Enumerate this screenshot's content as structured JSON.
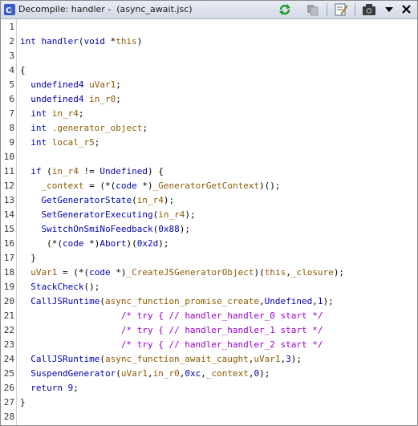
{
  "window": {
    "title": "Decompile: handler -  (async_await.jsc)"
  },
  "toolbar": {
    "icons": [
      "refresh-icon",
      "copy-icon",
      "edit-icon",
      "snapshot-icon",
      "dropdown-icon",
      "close-icon"
    ]
  },
  "code": {
    "lines": [
      {
        "n": "1",
        "tokens": []
      },
      {
        "n": "2",
        "tokens": [
          [
            "tp",
            "int"
          ],
          [
            "pl",
            " "
          ],
          [
            "fn",
            "handler"
          ],
          [
            "pl",
            "("
          ],
          [
            "tp",
            "void"
          ],
          [
            "pl",
            " *"
          ],
          [
            "vr",
            "this"
          ],
          [
            "pl",
            ")"
          ]
        ]
      },
      {
        "n": "3",
        "tokens": []
      },
      {
        "n": "4",
        "tokens": [
          [
            "pl",
            "{"
          ]
        ]
      },
      {
        "n": "5",
        "tokens": [
          [
            "pl",
            "  "
          ],
          [
            "tp",
            "undefined4"
          ],
          [
            "pl",
            " "
          ],
          [
            "vr",
            "uVar1"
          ],
          [
            "pl",
            ";"
          ]
        ]
      },
      {
        "n": "6",
        "tokens": [
          [
            "pl",
            "  "
          ],
          [
            "tp",
            "undefined4"
          ],
          [
            "pl",
            " "
          ],
          [
            "vr",
            "in_r0"
          ],
          [
            "pl",
            ";"
          ]
        ]
      },
      {
        "n": "7",
        "tokens": [
          [
            "pl",
            "  "
          ],
          [
            "tp",
            "int"
          ],
          [
            "pl",
            " "
          ],
          [
            "vr",
            "in_r4"
          ],
          [
            "pl",
            ";"
          ]
        ]
      },
      {
        "n": "8",
        "tokens": [
          [
            "pl",
            "  "
          ],
          [
            "tp",
            "int"
          ],
          [
            "pl",
            " "
          ],
          [
            "vr",
            ".generator_object"
          ],
          [
            "pl",
            ";"
          ]
        ]
      },
      {
        "n": "9",
        "tokens": [
          [
            "pl",
            "  "
          ],
          [
            "tp",
            "int"
          ],
          [
            "pl",
            " "
          ],
          [
            "vr",
            "local_r5"
          ],
          [
            "pl",
            ";"
          ]
        ]
      },
      {
        "n": "10",
        "tokens": []
      },
      {
        "n": "11",
        "tokens": [
          [
            "pl",
            "  "
          ],
          [
            "kw",
            "if"
          ],
          [
            "pl",
            " ("
          ],
          [
            "vr",
            "in_r4"
          ],
          [
            "pl",
            " != "
          ],
          [
            "cn",
            "Undefined"
          ],
          [
            "pl",
            ") {"
          ]
        ]
      },
      {
        "n": "12",
        "tokens": [
          [
            "pl",
            "    "
          ],
          [
            "gl",
            "_context"
          ],
          [
            "pl",
            " = (*("
          ],
          [
            "tp",
            "code"
          ],
          [
            "pl",
            " *)"
          ],
          [
            "gl",
            "_GeneratorGetContext"
          ],
          [
            "pl",
            ")();"
          ]
        ]
      },
      {
        "n": "13",
        "tokens": [
          [
            "pl",
            "    "
          ],
          [
            "fn",
            "GetGeneratorState"
          ],
          [
            "pl",
            "("
          ],
          [
            "vr",
            "in_r4"
          ],
          [
            "pl",
            ");"
          ]
        ]
      },
      {
        "n": "14",
        "tokens": [
          [
            "pl",
            "    "
          ],
          [
            "fn",
            "SetGeneratorExecuting"
          ],
          [
            "pl",
            "("
          ],
          [
            "vr",
            "in_r4"
          ],
          [
            "pl",
            ");"
          ]
        ]
      },
      {
        "n": "15",
        "tokens": [
          [
            "pl",
            "    "
          ],
          [
            "fn",
            "SwitchOnSmiNoFeedback"
          ],
          [
            "pl",
            "("
          ],
          [
            "cn",
            "0x88"
          ],
          [
            "pl",
            ");"
          ]
        ]
      },
      {
        "n": "16",
        "tokens": [
          [
            "pl",
            "     (*("
          ],
          [
            "tp",
            "code"
          ],
          [
            "pl",
            " *)"
          ],
          [
            "fn",
            "Abort"
          ],
          [
            "pl",
            ")("
          ],
          [
            "cn",
            "0x2d"
          ],
          [
            "pl",
            ");"
          ]
        ]
      },
      {
        "n": "17",
        "tokens": [
          [
            "pl",
            "  }"
          ]
        ]
      },
      {
        "n": "18",
        "tokens": [
          [
            "pl",
            "  "
          ],
          [
            "vr",
            "uVar1"
          ],
          [
            "pl",
            " = (*("
          ],
          [
            "tp",
            "code"
          ],
          [
            "pl",
            " *)"
          ],
          [
            "gl",
            "_CreateJSGeneratorObject"
          ],
          [
            "pl",
            ")("
          ],
          [
            "vr",
            "this"
          ],
          [
            "pl",
            ","
          ],
          [
            "gl",
            "_closure"
          ],
          [
            "pl",
            ");"
          ]
        ]
      },
      {
        "n": "19",
        "tokens": [
          [
            "pl",
            "  "
          ],
          [
            "fn",
            "StackCheck"
          ],
          [
            "pl",
            "();"
          ]
        ]
      },
      {
        "n": "20",
        "tokens": [
          [
            "pl",
            "  "
          ],
          [
            "fn",
            "CallJSRuntime"
          ],
          [
            "pl",
            "("
          ],
          [
            "gl",
            "async_function_promise_create"
          ],
          [
            "pl",
            ","
          ],
          [
            "cn",
            "Undefined"
          ],
          [
            "pl",
            ","
          ],
          [
            "cn",
            "1"
          ],
          [
            "pl",
            ");"
          ]
        ]
      },
      {
        "n": "21",
        "tokens": [
          [
            "pl",
            "                   "
          ],
          [
            "cm",
            "/* try { // handler_handler_0 start */"
          ]
        ]
      },
      {
        "n": "22",
        "tokens": [
          [
            "pl",
            "                   "
          ],
          [
            "cm",
            "/* try { // handler_handler_1 start */"
          ]
        ]
      },
      {
        "n": "23",
        "tokens": [
          [
            "pl",
            "                   "
          ],
          [
            "cm",
            "/* try { // handler_handler_2 start */"
          ]
        ]
      },
      {
        "n": "24",
        "tokens": [
          [
            "pl",
            "  "
          ],
          [
            "fn",
            "CallJSRuntime"
          ],
          [
            "pl",
            "("
          ],
          [
            "gl",
            "async_function_await_caught"
          ],
          [
            "pl",
            ","
          ],
          [
            "vr",
            "uVar1"
          ],
          [
            "pl",
            ","
          ],
          [
            "cn",
            "3"
          ],
          [
            "pl",
            ");"
          ]
        ]
      },
      {
        "n": "25",
        "tokens": [
          [
            "pl",
            "  "
          ],
          [
            "fn",
            "SuspendGenerator"
          ],
          [
            "pl",
            "("
          ],
          [
            "vr",
            "uVar1"
          ],
          [
            "pl",
            ","
          ],
          [
            "vr",
            "in_r0"
          ],
          [
            "pl",
            ","
          ],
          [
            "cn",
            "0xc"
          ],
          [
            "pl",
            ","
          ],
          [
            "gl",
            "_context"
          ],
          [
            "pl",
            ","
          ],
          [
            "cn",
            "0"
          ],
          [
            "pl",
            ");"
          ]
        ]
      },
      {
        "n": "26",
        "tokens": [
          [
            "pl",
            "  "
          ],
          [
            "kw",
            "return"
          ],
          [
            "pl",
            " "
          ],
          [
            "cn",
            "9"
          ],
          [
            "pl",
            ";"
          ]
        ]
      },
      {
        "n": "27",
        "tokens": [
          [
            "pl",
            "}"
          ]
        ]
      },
      {
        "n": "28",
        "tokens": []
      }
    ]
  }
}
